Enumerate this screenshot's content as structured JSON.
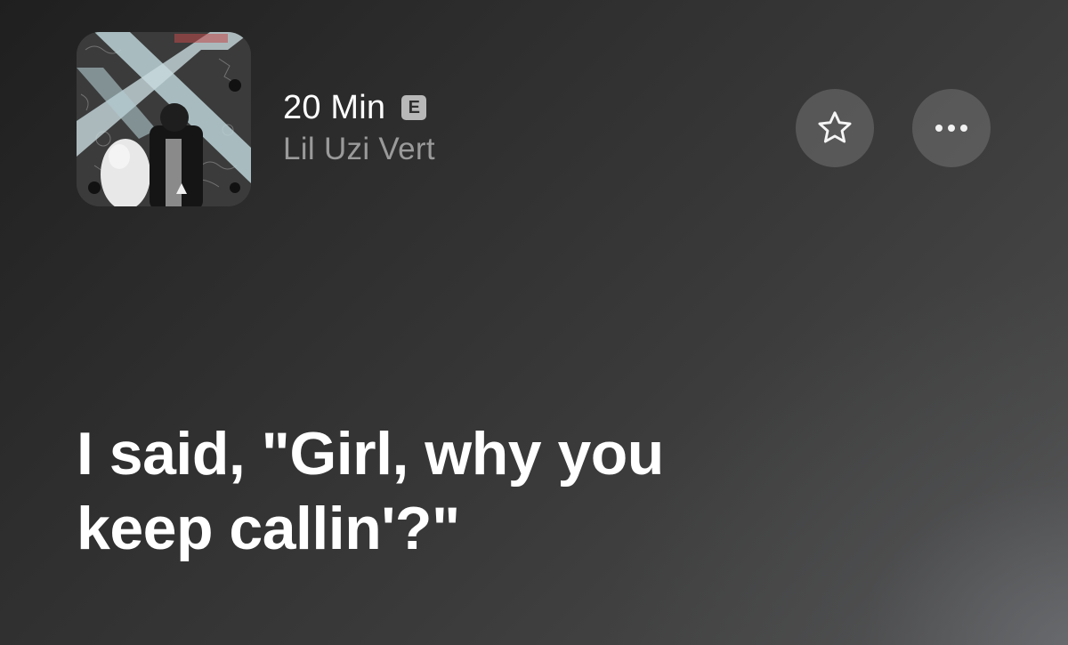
{
  "now_playing": {
    "title": "20 Min",
    "explicit_badge": "E",
    "artist": "Lil Uzi Vert",
    "artwork_icon": "album-cover"
  },
  "actions": {
    "favorite_icon": "star-icon",
    "more_icon": "ellipsis-icon"
  },
  "lyrics": {
    "lines": [
      "I said, \"Girl, why you",
      "keep callin'?\""
    ]
  },
  "colors": {
    "text_primary": "#ffffff",
    "text_secondary": "#9a9a9a",
    "button_bg": "#6e6e6e",
    "badge_bg": "#b8b8b8"
  }
}
